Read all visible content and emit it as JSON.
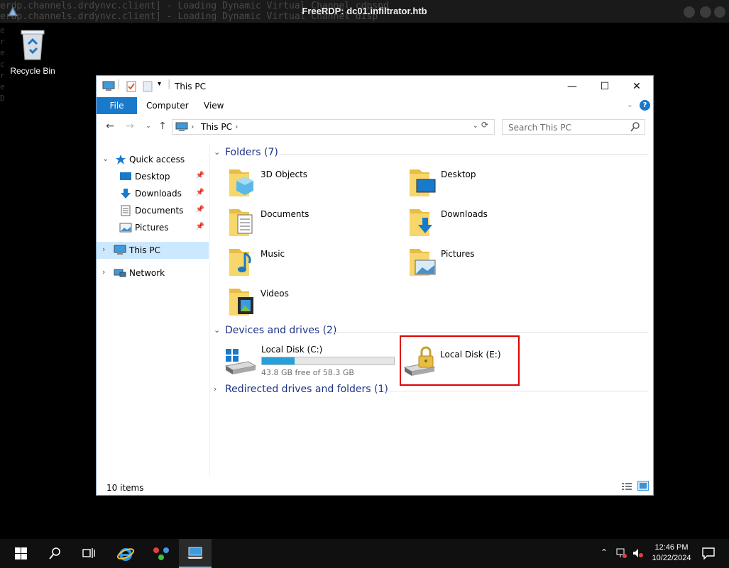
{
  "rdp": {
    "title": "FreeRDP: dc01.infiltrator.htb",
    "terminal_line_1": "erdp.channels.drdynvc.client] - Loading Dynamic Virtual Channel cdpsnd",
    "terminal_line_2": "erdp.channels.drdynvc.client] - Loading Dynamic Virtual Channel disp",
    "left_fragments": [
      "e",
      "r",
      "e",
      "c",
      "r",
      "e",
      "D",
      "r",
      "r",
      "e",
      "s"
    ]
  },
  "desktop": {
    "recycle_bin_label": "Recycle Bin"
  },
  "window": {
    "title": "This PC",
    "tabs": {
      "file": "File",
      "computer": "Computer",
      "view": "View"
    },
    "address": {
      "location": "This PC"
    },
    "search_placeholder": "Search This PC",
    "help_label": "?"
  },
  "nav": {
    "quick_access": "Quick access",
    "desktop": "Desktop",
    "downloads": "Downloads",
    "documents": "Documents",
    "pictures": "Pictures",
    "this_pc": "This PC",
    "network": "Network"
  },
  "content": {
    "folders_header": "Folders (7)",
    "folders": [
      "3D Objects",
      "Desktop",
      "Documents",
      "Downloads",
      "Music",
      "Pictures",
      "Videos"
    ],
    "devices_header": "Devices and drives (2)",
    "drive_c": {
      "label": "Local Disk (C:)",
      "free": "43.8 GB free of 58.3 GB",
      "used_fraction": 0.249
    },
    "drive_e": {
      "label": "Local Disk (E:)"
    },
    "redirected_header": "Redirected drives and folders (1)"
  },
  "status": {
    "items": "10 items"
  },
  "taskbar": {
    "time": "12:46 PM",
    "date": "10/22/2024"
  },
  "colors": {
    "accent": "#1979ca",
    "selection": "#cce8ff",
    "group_header": "#1e3287",
    "highlight_box": "#e00000",
    "progress": "#26a0da"
  }
}
